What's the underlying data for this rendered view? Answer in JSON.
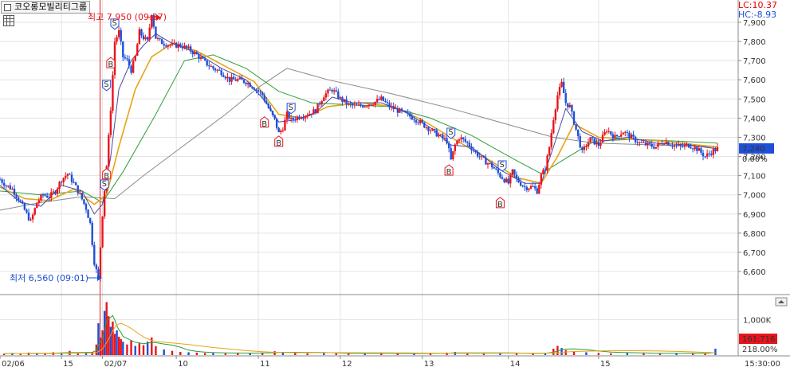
{
  "header": {
    "stock_name": "코오롱모빌리티그룹",
    "lc_label": "LC:10.37",
    "hc_label": "HC:-8.93"
  },
  "colors": {
    "up": "#e8141c",
    "down": "#1f4fd8",
    "ma_fast": "#4a4aa0",
    "ma_mid": "#e8a317",
    "ma_slow": "#2e9e3a",
    "ma_long": "#8a8a8a",
    "grid": "#e3e3e3"
  },
  "chart_data": [
    {
      "type": "line",
      "description_labels": {
        "high_annotation": "최고 7,950 (09:37)",
        "low_annotation": "최저 6,560 (09:01)"
      },
      "ylim": [
        6500,
        7950
      ],
      "y_ticks": [
        "7,900",
        "7,800",
        "7,700",
        "7,600",
        "7,500",
        "7,400",
        "7,300",
        "7,200",
        "7,100",
        "7,000",
        "6,900",
        "6,800",
        "6,700",
        "6,600"
      ],
      "y_tick_values": [
        7900,
        7800,
        7700,
        7600,
        7500,
        7400,
        7300,
        7200,
        7100,
        7000,
        6900,
        6800,
        6700,
        6600
      ],
      "current_price_label": "7,240",
      "current_price_value": 7240,
      "change_label": "0.00%",
      "x_labels": [
        "02/06",
        "15",
        "02/07",
        "10",
        "11",
        "12",
        "13",
        "14",
        "15",
        "15:30:00"
      ],
      "price_path": [
        [
          0,
          7080
        ],
        [
          3,
          7050
        ],
        [
          6,
          7030
        ],
        [
          9,
          6980
        ],
        [
          12,
          6920
        ],
        [
          15,
          6860
        ],
        [
          18,
          6960
        ],
        [
          21,
          7000
        ],
        [
          24,
          6990
        ],
        [
          27,
          7020
        ],
        [
          30,
          7080
        ],
        [
          33,
          7110
        ],
        [
          36,
          7060
        ],
        [
          39,
          7000
        ],
        [
          42,
          6930
        ],
        [
          44,
          6850
        ],
        [
          46,
          6650
        ],
        [
          48,
          6560
        ],
        [
          50,
          6900
        ],
        [
          52,
          7150
        ],
        [
          54,
          7450
        ],
        [
          56,
          7800
        ],
        [
          58,
          7850
        ],
        [
          60,
          7720
        ],
        [
          62,
          7700
        ],
        [
          64,
          7650
        ],
        [
          66,
          7720
        ],
        [
          68,
          7850
        ],
        [
          70,
          7820
        ],
        [
          72,
          7800
        ],
        [
          74,
          7950
        ],
        [
          76,
          7820
        ],
        [
          78,
          7800
        ],
        [
          80,
          7790
        ],
        [
          84,
          7780
        ],
        [
          88,
          7780
        ],
        [
          92,
          7760
        ],
        [
          96,
          7730
        ],
        [
          100,
          7690
        ],
        [
          104,
          7660
        ],
        [
          108,
          7640
        ],
        [
          112,
          7600
        ],
        [
          116,
          7600
        ],
        [
          120,
          7590
        ],
        [
          124,
          7560
        ],
        [
          128,
          7520
        ],
        [
          132,
          7430
        ],
        [
          134,
          7390
        ],
        [
          136,
          7320
        ],
        [
          138,
          7350
        ],
        [
          140,
          7420
        ],
        [
          142,
          7390
        ],
        [
          146,
          7410
        ],
        [
          150,
          7420
        ],
        [
          154,
          7440
        ],
        [
          158,
          7520
        ],
        [
          162,
          7550
        ],
        [
          166,
          7500
        ],
        [
          170,
          7470
        ],
        [
          174,
          7460
        ],
        [
          178,
          7470
        ],
        [
          182,
          7480
        ],
        [
          186,
          7500
        ],
        [
          190,
          7460
        ],
        [
          194,
          7440
        ],
        [
          198,
          7420
        ],
        [
          202,
          7400
        ],
        [
          206,
          7370
        ],
        [
          210,
          7340
        ],
        [
          214,
          7310
        ],
        [
          218,
          7280
        ],
        [
          220,
          7180
        ],
        [
          222,
          7260
        ],
        [
          224,
          7300
        ],
        [
          228,
          7270
        ],
        [
          232,
          7220
        ],
        [
          236,
          7180
        ],
        [
          240,
          7150
        ],
        [
          244,
          7100
        ],
        [
          248,
          7060
        ],
        [
          250,
          7120
        ],
        [
          252,
          7080
        ],
        [
          256,
          7040
        ],
        [
          260,
          7040
        ],
        [
          262,
          7020
        ],
        [
          264,
          7100
        ],
        [
          266,
          7140
        ],
        [
          268,
          7250
        ],
        [
          270,
          7400
        ],
        [
          272,
          7520
        ],
        [
          274,
          7580
        ],
        [
          276,
          7480
        ],
        [
          278,
          7460
        ],
        [
          280,
          7380
        ],
        [
          282,
          7300
        ],
        [
          284,
          7220
        ],
        [
          286,
          7260
        ],
        [
          288,
          7290
        ],
        [
          292,
          7260
        ],
        [
          296,
          7340
        ],
        [
          300,
          7300
        ],
        [
          304,
          7330
        ],
        [
          308,
          7300
        ],
        [
          312,
          7270
        ],
        [
          316,
          7260
        ],
        [
          320,
          7250
        ],
        [
          324,
          7280
        ],
        [
          328,
          7260
        ],
        [
          332,
          7250
        ],
        [
          336,
          7260
        ],
        [
          340,
          7240
        ],
        [
          344,
          7200
        ],
        [
          348,
          7230
        ],
        [
          350,
          7240
        ]
      ],
      "ma_fast_path": [
        [
          0,
          7050
        ],
        [
          10,
          6960
        ],
        [
          20,
          6940
        ],
        [
          30,
          7050
        ],
        [
          40,
          7020
        ],
        [
          46,
          6900
        ],
        [
          50,
          6950
        ],
        [
          54,
          7200
        ],
        [
          58,
          7550
        ],
        [
          64,
          7700
        ],
        [
          70,
          7780
        ],
        [
          76,
          7840
        ],
        [
          84,
          7790
        ],
        [
          96,
          7740
        ],
        [
          108,
          7660
        ],
        [
          120,
          7600
        ],
        [
          130,
          7480
        ],
        [
          136,
          7380
        ],
        [
          144,
          7390
        ],
        [
          154,
          7430
        ],
        [
          162,
          7510
        ],
        [
          172,
          7480
        ],
        [
          186,
          7480
        ],
        [
          198,
          7430
        ],
        [
          210,
          7350
        ],
        [
          220,
          7260
        ],
        [
          230,
          7250
        ],
        [
          244,
          7130
        ],
        [
          256,
          7060
        ],
        [
          264,
          7060
        ],
        [
          270,
          7250
        ],
        [
          276,
          7450
        ],
        [
          284,
          7330
        ],
        [
          294,
          7280
        ],
        [
          306,
          7300
        ],
        [
          320,
          7270
        ],
        [
          336,
          7260
        ],
        [
          350,
          7240
        ]
      ],
      "ma_mid_path": [
        [
          0,
          7040
        ],
        [
          12,
          6980
        ],
        [
          24,
          6970
        ],
        [
          36,
          7030
        ],
        [
          46,
          6950
        ],
        [
          52,
          7000
        ],
        [
          58,
          7250
        ],
        [
          66,
          7550
        ],
        [
          74,
          7720
        ],
        [
          84,
          7790
        ],
        [
          96,
          7750
        ],
        [
          110,
          7670
        ],
        [
          124,
          7590
        ],
        [
          136,
          7420
        ],
        [
          148,
          7400
        ],
        [
          160,
          7460
        ],
        [
          176,
          7480
        ],
        [
          192,
          7460
        ],
        [
          206,
          7390
        ],
        [
          220,
          7300
        ],
        [
          236,
          7200
        ],
        [
          252,
          7090
        ],
        [
          264,
          7060
        ],
        [
          272,
          7200
        ],
        [
          280,
          7370
        ],
        [
          292,
          7300
        ],
        [
          308,
          7290
        ],
        [
          324,
          7280
        ],
        [
          340,
          7260
        ],
        [
          350,
          7250
        ]
      ],
      "ma_slow_path": [
        [
          0,
          7020
        ],
        [
          20,
          7000
        ],
        [
          40,
          7020
        ],
        [
          50,
          6960
        ],
        [
          60,
          7120
        ],
        [
          76,
          7420
        ],
        [
          90,
          7700
        ],
        [
          104,
          7730
        ],
        [
          120,
          7660
        ],
        [
          136,
          7540
        ],
        [
          152,
          7480
        ],
        [
          170,
          7470
        ],
        [
          190,
          7460
        ],
        [
          210,
          7400
        ],
        [
          230,
          7310
        ],
        [
          250,
          7190
        ],
        [
          264,
          7110
        ],
        [
          276,
          7190
        ],
        [
          290,
          7280
        ],
        [
          310,
          7290
        ],
        [
          330,
          7280
        ],
        [
          350,
          7270
        ]
      ],
      "ma_long_path": [
        [
          0,
          6920
        ],
        [
          20,
          6960
        ],
        [
          40,
          6990
        ],
        [
          56,
          6980
        ],
        [
          70,
          7100
        ],
        [
          90,
          7260
        ],
        [
          110,
          7420
        ],
        [
          126,
          7560
        ],
        [
          140,
          7660
        ],
        [
          160,
          7600
        ],
        [
          190,
          7530
        ],
        [
          220,
          7450
        ],
        [
          250,
          7360
        ],
        [
          270,
          7300
        ],
        [
          290,
          7270
        ],
        [
          320,
          7260
        ],
        [
          350,
          7250
        ]
      ],
      "signals": [
        {
          "label": "S",
          "kind": "sell",
          "i": 56,
          "value": 7880
        },
        {
          "label": "B",
          "kind": "buy",
          "i": 54,
          "value": 7700
        },
        {
          "label": "S",
          "kind": "sell",
          "i": 52,
          "value": 7560
        },
        {
          "label": "B",
          "kind": "buy",
          "i": 52,
          "value": 7120
        },
        {
          "label": "S",
          "kind": "sell",
          "i": 51,
          "value": 7040
        },
        {
          "label": "B",
          "kind": "buy",
          "i": 129,
          "value": 7390
        },
        {
          "label": "B",
          "kind": "buy",
          "i": 136,
          "value": 7290
        },
        {
          "label": "S",
          "kind": "sell",
          "i": 142,
          "value": 7440
        },
        {
          "label": "S",
          "kind": "sell",
          "i": 220,
          "value": 7310
        },
        {
          "label": "B",
          "kind": "buy",
          "i": 219,
          "value": 7140
        },
        {
          "label": "S",
          "kind": "sell",
          "i": 245,
          "value": 7140
        },
        {
          "label": "B",
          "kind": "buy",
          "i": 244,
          "value": 6970
        }
      ]
    },
    {
      "type": "bar",
      "y_ticks": [
        "1,000K"
      ],
      "y_tick_values": [
        1000
      ],
      "ylim": [
        0,
        1600
      ],
      "volume_label": "161,716",
      "ratio_label": "218.00%",
      "volume_bars": [
        [
          2,
          40
        ],
        [
          6,
          60
        ],
        [
          10,
          30
        ],
        [
          14,
          70
        ],
        [
          18,
          50
        ],
        [
          22,
          40
        ],
        [
          26,
          80
        ],
        [
          30,
          60
        ],
        [
          34,
          120
        ],
        [
          38,
          50
        ],
        [
          42,
          70
        ],
        [
          45,
          90
        ],
        [
          47,
          300
        ],
        [
          48,
          900
        ],
        [
          49,
          500
        ],
        [
          50,
          700
        ],
        [
          51,
          1250
        ],
        [
          52,
          1500
        ],
        [
          53,
          1100
        ],
        [
          54,
          800
        ],
        [
          55,
          950
        ],
        [
          56,
          600
        ],
        [
          57,
          700
        ],
        [
          58,
          520
        ],
        [
          59,
          450
        ],
        [
          60,
          380
        ],
        [
          62,
          300
        ],
        [
          64,
          420
        ],
        [
          66,
          260
        ],
        [
          68,
          350
        ],
        [
          70,
          280
        ],
        [
          72,
          380
        ],
        [
          74,
          500
        ],
        [
          76,
          250
        ],
        [
          80,
          160
        ],
        [
          84,
          120
        ],
        [
          88,
          90
        ],
        [
          92,
          80
        ],
        [
          96,
          70
        ],
        [
          100,
          60
        ],
        [
          104,
          60
        ],
        [
          110,
          50
        ],
        [
          116,
          50
        ],
        [
          122,
          60
        ],
        [
          128,
          70
        ],
        [
          134,
          110
        ],
        [
          138,
          90
        ],
        [
          144,
          60
        ],
        [
          150,
          50
        ],
        [
          158,
          60
        ],
        [
          164,
          50
        ],
        [
          170,
          40
        ],
        [
          178,
          40
        ],
        [
          186,
          60
        ],
        [
          194,
          50
        ],
        [
          202,
          40
        ],
        [
          210,
          50
        ],
        [
          218,
          70
        ],
        [
          222,
          90
        ],
        [
          228,
          50
        ],
        [
          236,
          40
        ],
        [
          244,
          60
        ],
        [
          252,
          50
        ],
        [
          260,
          40
        ],
        [
          266,
          60
        ],
        [
          270,
          180
        ],
        [
          272,
          260
        ],
        [
          274,
          200
        ],
        [
          276,
          140
        ],
        [
          280,
          100
        ],
        [
          286,
          80
        ],
        [
          292,
          60
        ],
        [
          298,
          50
        ],
        [
          306,
          60
        ],
        [
          314,
          50
        ],
        [
          322,
          40
        ],
        [
          330,
          60
        ],
        [
          338,
          50
        ],
        [
          344,
          40
        ],
        [
          349,
          180
        ]
      ]
    }
  ]
}
